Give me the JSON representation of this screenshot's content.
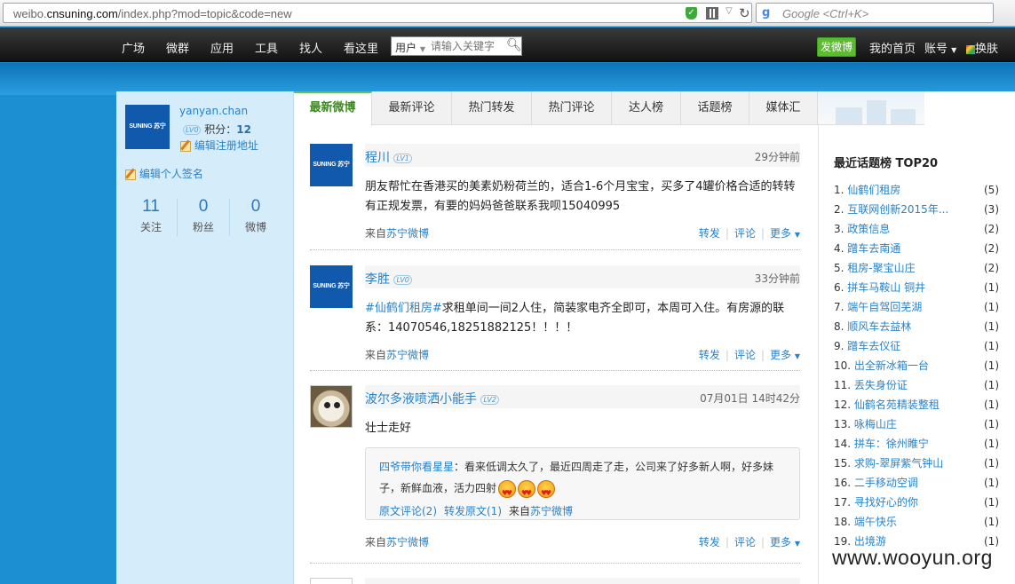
{
  "browser": {
    "url_prefix": "weibo.",
    "url_domain": "cnsuning.com",
    "url_path": "/index.php?mod=topic&code=new",
    "search_placeholder": "Google <Ctrl+K>"
  },
  "nav": {
    "items": [
      "广场",
      "微群",
      "应用",
      "工具",
      "找人",
      "看这里"
    ],
    "search_scope": "用户",
    "search_placeholder": "请输入关键字",
    "post_label": "发微博",
    "home_label": "我的首页",
    "account_label": "账号",
    "skin_label": "换肤"
  },
  "me": {
    "avatar_text": "SUNING 苏宁",
    "name": "yanyan.chan",
    "level": "LV0",
    "points_label": "积分：",
    "points": "12",
    "edit_address": "编辑注册地址",
    "edit_signature": "编辑个人签名",
    "stats": [
      {
        "num": "11",
        "label": "关注"
      },
      {
        "num": "0",
        "label": "粉丝"
      },
      {
        "num": "0",
        "label": "微博"
      }
    ]
  },
  "tabs": [
    "最新微博",
    "最新评论",
    "热门转发",
    "热门评论",
    "达人榜",
    "话题榜",
    "媒体汇"
  ],
  "posts": [
    {
      "author": "程川",
      "level": "LV1",
      "time": "29分钟前",
      "text": "朋友帮忙在香港买的美素奶粉荷兰的，适合1-6个月宝宝，买多了4罐价格合适的转转有正规发票，有要的妈妈爸爸联系我呗15040995",
      "via_prefix": "来自",
      "via_source": "苏宁微博"
    },
    {
      "author": "李胜",
      "level": "LV0",
      "time": "33分钟前",
      "hashtag": "#仙鹤们租房#",
      "text": "求租单间一间2人住，简装家电齐全即可，本周可入住。有房源的联系：14070546,18251882125！！！！",
      "via_prefix": "来自",
      "via_source": "苏宁微博"
    },
    {
      "author": "波尔多液喷洒小能手",
      "level": "LV2",
      "time": "07月01日 14时42分",
      "text": "壮士走好",
      "repost": {
        "user": "四爷带你看星星",
        "text": "：看来低调太久了，最近四周走了走，公司来了好多新人啊，好多妹子，新鲜血液，活力四射",
        "orig_comments": "原文评论(2)",
        "orig_reposts": "转发原文(1)",
        "via_prefix": "来自",
        "via_source": "苏宁微博"
      },
      "via_prefix": "来自",
      "via_source": "苏宁微博"
    }
  ],
  "actions": {
    "repost": "转发",
    "comment": "评论",
    "more": "更多"
  },
  "topics": {
    "title": "最近话题榜 TOP20",
    "items": [
      {
        "rank": "1.",
        "name": "仙鹤们租房",
        "count": "(5)"
      },
      {
        "rank": "2.",
        "name": "互联网创新2015年...",
        "count": "(3)"
      },
      {
        "rank": "3.",
        "name": "政策信息",
        "count": "(2)"
      },
      {
        "rank": "4.",
        "name": "蹭车去南通",
        "count": "(2)"
      },
      {
        "rank": "5.",
        "name": "租房-聚宝山庄",
        "count": "(2)"
      },
      {
        "rank": "6.",
        "name": "拼车马鞍山 铜井",
        "count": "(1)"
      },
      {
        "rank": "7.",
        "name": "端午自驾回芜湖",
        "count": "(1)"
      },
      {
        "rank": "8.",
        "name": "顺风车去益林",
        "count": "(1)"
      },
      {
        "rank": "9.",
        "name": "蹭车去仪征",
        "count": "(1)"
      },
      {
        "rank": "10.",
        "name": "出全新冰箱一台",
        "count": "(1)"
      },
      {
        "rank": "11.",
        "name": "丢失身份证",
        "count": "(1)"
      },
      {
        "rank": "12.",
        "name": "仙鹤名苑精装整租",
        "count": "(1)"
      },
      {
        "rank": "13.",
        "name": "咏梅山庄",
        "count": "(1)"
      },
      {
        "rank": "14.",
        "name": "拼车：徐州睢宁",
        "count": "(1)"
      },
      {
        "rank": "15.",
        "name": "求购-翠屏紫气钟山",
        "count": "(1)"
      },
      {
        "rank": "16.",
        "name": "二手移动空调",
        "count": "(1)"
      },
      {
        "rank": "17.",
        "name": "寻找好心的你",
        "count": "(1)"
      },
      {
        "rank": "18.",
        "name": "端午快乐",
        "count": "(1)"
      },
      {
        "rank": "19.",
        "name": "出境游",
        "count": "(1)"
      }
    ]
  },
  "watermark": "www.wooyun.org"
}
